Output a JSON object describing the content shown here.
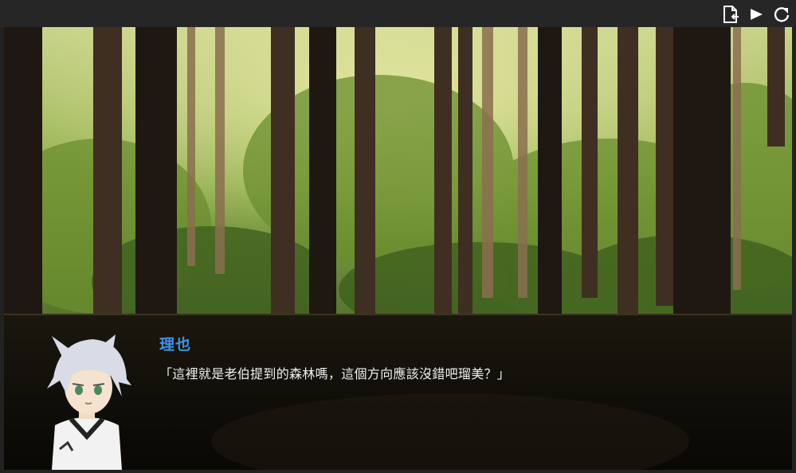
{
  "toolbar": {
    "icons": [
      "exit-file-icon",
      "play-icon",
      "restart-icon"
    ]
  },
  "dialog": {
    "speaker": "理也",
    "text": "「這裡就是老伯提到的森林嗎，這個方向應該沒錯吧瑠美？」",
    "speaker_color": "#3a95e8"
  },
  "scene": {
    "background": "forest"
  }
}
